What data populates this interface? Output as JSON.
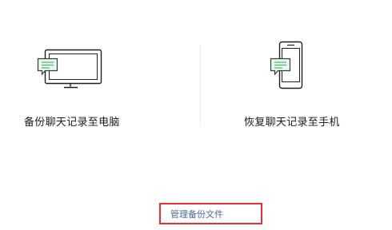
{
  "options": [
    {
      "label": "备份聊天记录至电脑",
      "icon": "monitor-chat-icon"
    },
    {
      "label": "恢复聊天记录至手机",
      "icon": "phone-chat-icon"
    }
  ],
  "manage_link": {
    "label": "管理备份文件"
  },
  "colors": {
    "icon_stroke": "#1e1e1e",
    "bubble_fill": "#e9f7ec",
    "bubble_stroke": "#3a3a3a",
    "bubble_lines": "#4db56a",
    "highlight_border": "#e2313b",
    "link_text": "#4a6a9c"
  }
}
